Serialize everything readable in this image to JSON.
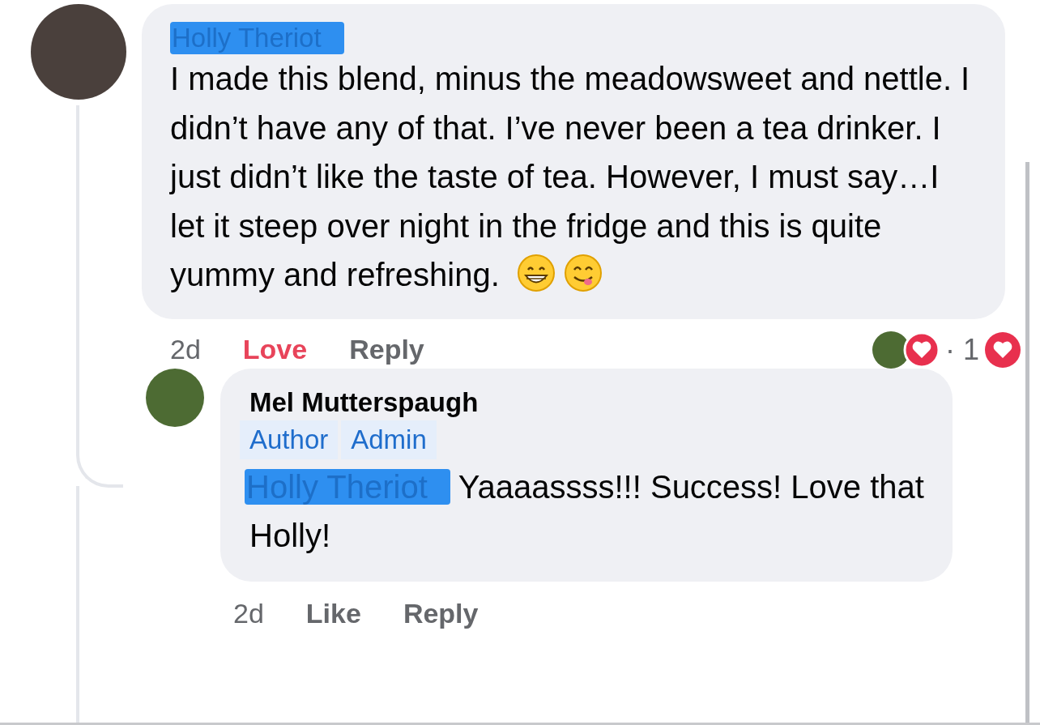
{
  "comment": {
    "author": "Holly Theriot",
    "author_redacted": true,
    "text": "I made this blend, minus the meadowsweet and nettle. I didn’t have any of that. I’ve never been a tea drinker. I just didn’t like the taste of tea. However, I must say…I let it steep over night in the fridge and this is quite yummy and refreshing.",
    "emojis": [
      {
        "kind": "grin"
      },
      {
        "kind": "yum"
      }
    ],
    "time": "2d",
    "actions": [
      {
        "label": "Love",
        "selected": true
      },
      {
        "label": "Reply",
        "selected": false
      }
    ],
    "reactions": {
      "count": "· 1"
    }
  },
  "reply": {
    "author": "Mel Mutterspaugh",
    "badges": [
      "Author",
      "Admin"
    ],
    "mention": "Holly Theriot",
    "mention_redacted": true,
    "text": "Yaaaassss!!! Success! Love that Holly!",
    "time": "2d",
    "actions": [
      {
        "label": "Like",
        "selected": false
      },
      {
        "label": "Reply",
        "selected": false
      }
    ]
  }
}
